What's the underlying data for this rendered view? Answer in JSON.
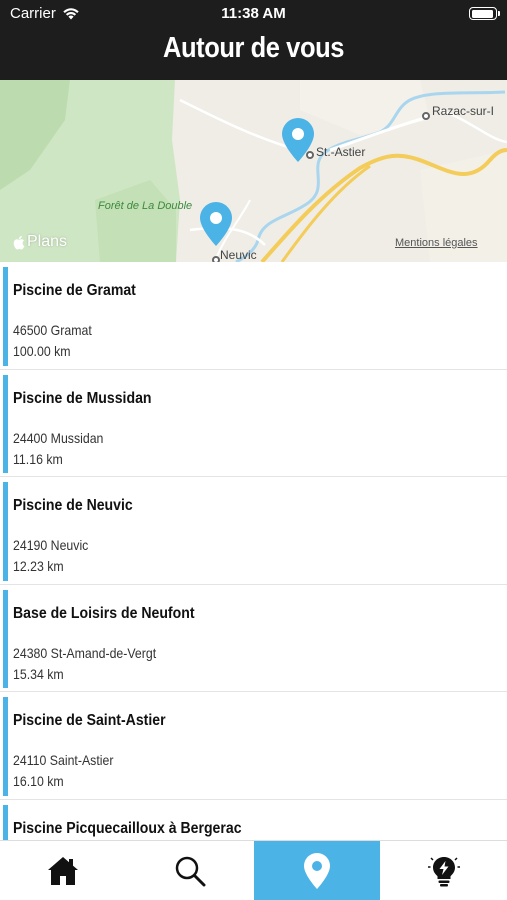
{
  "status_bar": {
    "carrier": "Carrier",
    "time": "11:38 AM",
    "battery_level": 0.95
  },
  "header": {
    "title": "Autour de vous"
  },
  "map": {
    "labels": {
      "razac": "Razac-sur-I",
      "st_astier": "St.-Astier",
      "forest": "Forêt de La Double",
      "neuvic": "Neuvic",
      "legal": "Mentions légales"
    },
    "logo_text": "Plans"
  },
  "colors": {
    "accent": "#4cb3e6",
    "header_bg": "#1d1d1d"
  },
  "pools": [
    {
      "name": "Piscine de Gramat",
      "address": "46500 Gramat",
      "distance": "100.00 km"
    },
    {
      "name": "Piscine de Mussidan",
      "address": "24400 Mussidan",
      "distance": "11.16 km"
    },
    {
      "name": "Piscine de Neuvic",
      "address": "24190 Neuvic",
      "distance": "12.23 km"
    },
    {
      "name": "Base de Loisirs de Neufont",
      "address": "24380 St-Amand-de-Vergt",
      "distance": "15.34 km"
    },
    {
      "name": "Piscine de Saint-Astier",
      "address": "24110 Saint-Astier",
      "distance": "16.10 km"
    },
    {
      "name": "Piscine Picquecailloux à Bergerac",
      "address": "",
      "distance": ""
    }
  ],
  "tabs": [
    {
      "icon": "home-icon",
      "active": false
    },
    {
      "icon": "search-icon",
      "active": false
    },
    {
      "icon": "map-pin-icon",
      "active": true
    },
    {
      "icon": "lightbulb-icon",
      "active": false
    }
  ]
}
